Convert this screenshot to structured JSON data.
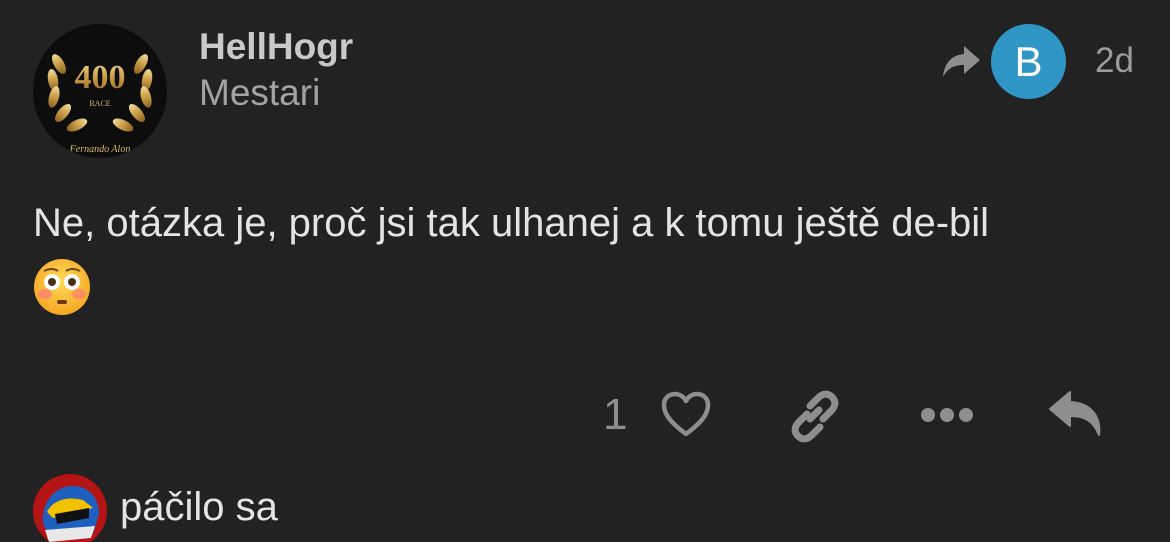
{
  "post": {
    "author": {
      "username": "HellHogr",
      "title": "Mestari",
      "avatar_badge": "400",
      "avatar_badge_sub": "RACE",
      "avatar_caption": "Fernando Alon"
    },
    "reply_to": {
      "icon": "share-arrow-icon",
      "avatar_letter": "B",
      "avatar_color": "#2f96c6"
    },
    "age": "2d",
    "body": "Ne, otázka je, proč jsi tak ulhanej a k tomu ještě de-bil",
    "emoji": "flushed-face-emoji",
    "actions": {
      "like_count": "1",
      "like_icon": "heart-icon",
      "link_icon": "link-icon",
      "more_icon": "more-icon",
      "reply_icon": "reply-icon"
    }
  },
  "liked_by": {
    "text": "páčilo sa"
  },
  "colors": {
    "background": "#222222",
    "primary_text": "#e4e4e4",
    "secondary_text": "#a3a3a3",
    "icon_gray": "#8e8e8e",
    "reply_avatar": "#2f96c6"
  }
}
